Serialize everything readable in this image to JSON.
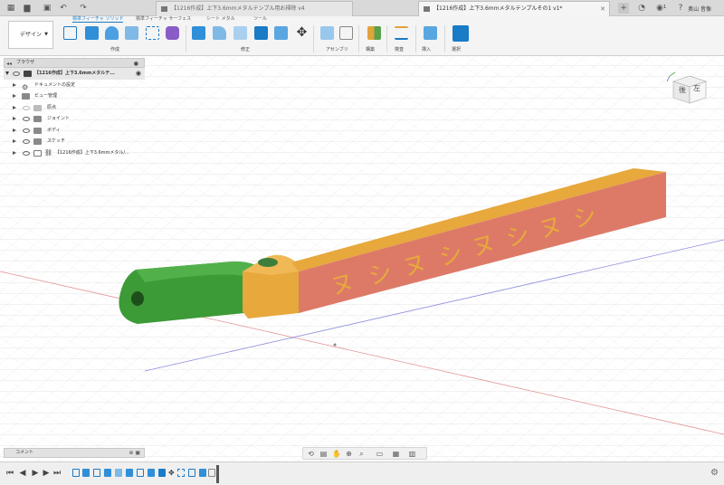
{
  "titlebar": {
    "tabs": [
      {
        "label": "【1216作成】上下3.6mmメタルテンプル用お掃除 v4",
        "active": false
      },
      {
        "label": "【1216作成】上下3.6mmメタルテンプルその1 v1*",
        "active": true
      }
    ],
    "user_name": "奥山 皆像",
    "notification_count": "1",
    "icons": [
      "grid-icon",
      "file-icon",
      "save-icon",
      "undo-icon",
      "redo-icon",
      "add-tab-icon",
      "data-panel-icon",
      "notification-icon",
      "help-icon"
    ]
  },
  "ribbon": {
    "workspace": "デザイン",
    "tabs": [
      {
        "label": "標準フィーチャ ソリッド",
        "active": true
      },
      {
        "label": "標準フィーチャ サーフェス",
        "active": false
      },
      {
        "label": "シート メタル",
        "active": false
      },
      {
        "label": "ツール",
        "active": false
      }
    ],
    "groups": [
      "作成",
      "修正",
      "アセンブリ",
      "構築",
      "検査",
      "挿入",
      "選択"
    ]
  },
  "browser": {
    "title": "ブラウザ",
    "root": "【1216作成】上下3.6mmメタルテ...",
    "items": [
      "ドキュメントの設定",
      "ビュー管理",
      "原点",
      "ジョイント",
      "ボディ",
      "スケッチ",
      "【1216作成】上下3.6mmメタル/..."
    ]
  },
  "viewcube": {
    "face_back": "後",
    "face_left": "左"
  },
  "model": {
    "engraved_text": "ヌシヌシヌシヌシ",
    "colors": {
      "green": "#3c9a37",
      "orange": "#e7a83c",
      "salmon": "#dd7a67",
      "grid": "#d7d7d7"
    }
  },
  "comments": {
    "label": "コメント"
  },
  "navbar": {
    "icons": [
      "orbit-icon",
      "look-at-icon",
      "pan-icon",
      "zoom-icon",
      "fit-icon",
      "display-icon",
      "grid-settings-icon",
      "viewport-icon"
    ]
  },
  "timeline": {
    "feature_count": 17
  }
}
